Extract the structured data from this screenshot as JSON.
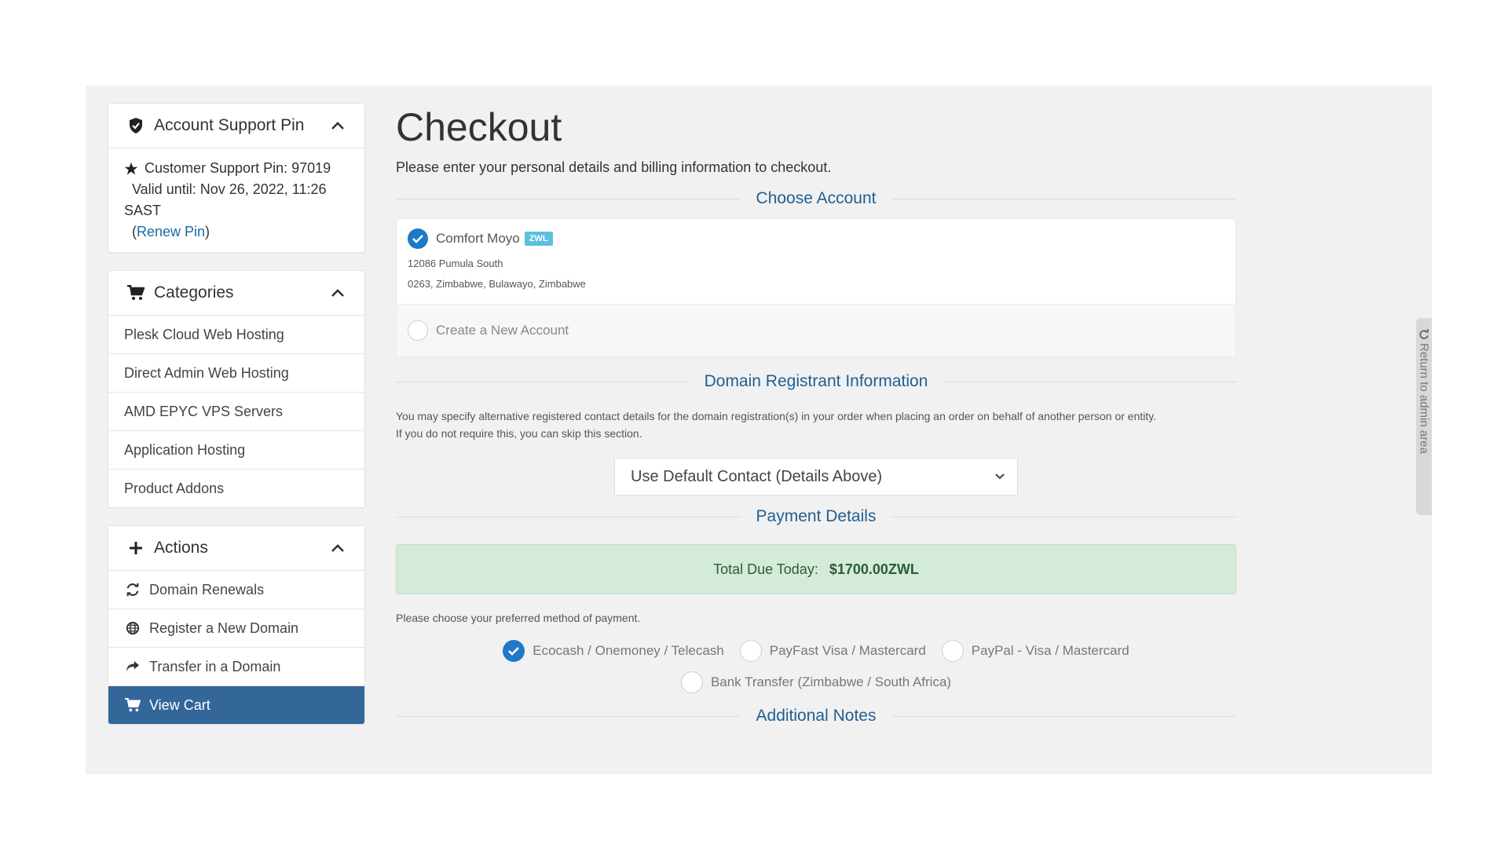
{
  "sidebar": {
    "support_pin": {
      "title": "Account Support Pin",
      "pin_label": "Customer Support Pin: 97019",
      "valid_until": "Valid until: Nov 26, 2022, 11:26",
      "tz": "SAST",
      "renew_open": "(",
      "renew_link": "Renew Pin",
      "renew_close": ")"
    },
    "categories": {
      "title": "Categories",
      "items": [
        {
          "label": "Plesk Cloud Web Hosting"
        },
        {
          "label": "Direct Admin Web Hosting"
        },
        {
          "label": "AMD EPYC VPS Servers"
        },
        {
          "label": "Application Hosting"
        },
        {
          "label": "Product Addons"
        }
      ]
    },
    "actions": {
      "title": "Actions",
      "items": [
        {
          "label": "Domain Renewals",
          "icon": "refresh-icon"
        },
        {
          "label": "Register a New Domain",
          "icon": "globe-icon"
        },
        {
          "label": "Transfer in a Domain",
          "icon": "share-icon"
        },
        {
          "label": "View Cart",
          "icon": "cart-icon",
          "active": true
        }
      ]
    }
  },
  "main": {
    "title": "Checkout",
    "subtitle": "Please enter your personal details and billing information to checkout.",
    "choose_account": {
      "heading": "Choose Account",
      "account_name": "Comfort Moyo",
      "currency_badge": "ZWL",
      "address_line1": "12086 Pumula South",
      "address_line2": "0263, Zimbabwe, Bulawayo, Zimbabwe",
      "new_account": "Create a New Account"
    },
    "domain_registrant": {
      "heading": "Domain Registrant Information",
      "note_line1": "You may specify alternative registered contact details for the domain registration(s) in your order when placing an order on behalf of another person or entity.",
      "note_line2": "If you do not require this, you can skip this section.",
      "select_value": "Use Default Contact (Details Above)"
    },
    "payment": {
      "heading": "Payment Details",
      "total_label": "Total Due Today:",
      "total_value": "$1700.00ZWL",
      "choose_note": "Please choose your preferred method of payment.",
      "methods": [
        {
          "label": "Ecocash / Onemoney / Telecash",
          "selected": true
        },
        {
          "label": "PayFast Visa / Mastercard",
          "selected": false
        },
        {
          "label": "PayPal - Visa / Mastercard",
          "selected": false
        },
        {
          "label": "Bank Transfer (Zimbabwe / South Africa)",
          "selected": false
        }
      ]
    },
    "additional_notes": {
      "heading": "Additional Notes"
    }
  },
  "return_tab": {
    "label": "Return to admin area"
  },
  "colors": {
    "accent": "#336699",
    "link": "#1a6aa6",
    "heading": "#1f5f92",
    "success_bg": "#d4ebd9"
  }
}
